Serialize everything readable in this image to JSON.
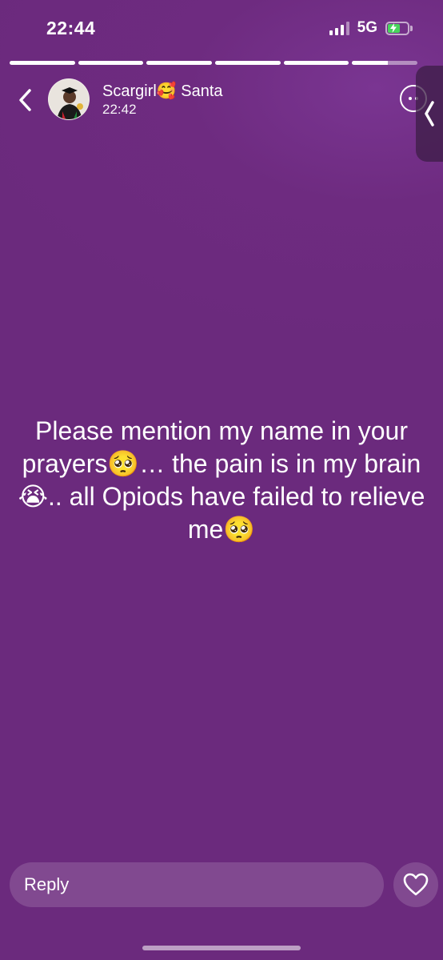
{
  "status_bar": {
    "time": "22:44",
    "network": "5G",
    "signal_bars": 3,
    "battery_charging": true
  },
  "story_progress": {
    "segments": [
      1,
      1,
      1,
      1,
      1,
      0.55
    ]
  },
  "header": {
    "user_name": "Scargirl🥰 Santa",
    "post_time": "22:42"
  },
  "story": {
    "text": "Please mention my name in your prayers🥺… the pain is in my brain 😭.. all Opiods have failed to relieve me🥺",
    "background_color": "#6b2a7d"
  },
  "reply": {
    "placeholder": "Reply"
  },
  "icons": {
    "back": "chevron-left-icon",
    "menu": "more-horizontal-icon",
    "side": "chevron-left-icon",
    "like": "heart-icon"
  }
}
